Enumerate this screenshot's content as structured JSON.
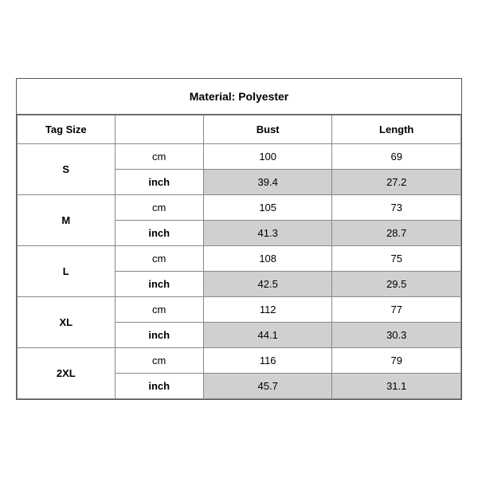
{
  "title": "Material: Polyester",
  "headers": {
    "tag_size": "Tag Size",
    "bust": "Bust",
    "length": "Length"
  },
  "sizes": [
    {
      "tag": "S",
      "cm": {
        "bust": "100",
        "length": "69"
      },
      "inch": {
        "bust": "39.4",
        "length": "27.2"
      }
    },
    {
      "tag": "M",
      "cm": {
        "bust": "105",
        "length": "73"
      },
      "inch": {
        "bust": "41.3",
        "length": "28.7"
      }
    },
    {
      "tag": "L",
      "cm": {
        "bust": "108",
        "length": "75"
      },
      "inch": {
        "bust": "42.5",
        "length": "29.5"
      }
    },
    {
      "tag": "XL",
      "cm": {
        "bust": "112",
        "length": "77"
      },
      "inch": {
        "bust": "44.1",
        "length": "30.3"
      }
    },
    {
      "tag": "2XL",
      "cm": {
        "bust": "116",
        "length": "79"
      },
      "inch": {
        "bust": "45.7",
        "length": "31.1"
      }
    }
  ],
  "units": {
    "cm": "cm",
    "inch": "inch"
  }
}
